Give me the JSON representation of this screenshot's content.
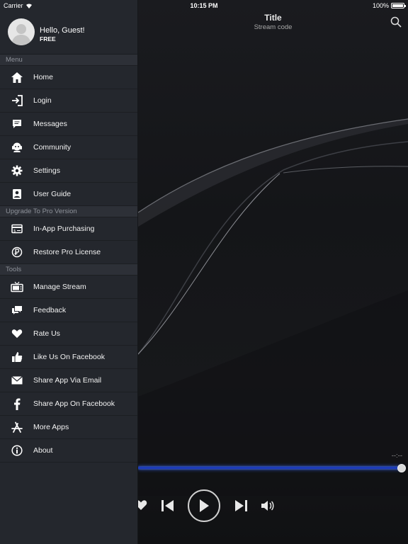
{
  "status_bar": {
    "carrier": "Carrier",
    "time": "10:15 PM",
    "battery": "100%"
  },
  "now_playing": {
    "title": "Title",
    "subtitle": "Stream code",
    "time_remaining": "--:--",
    "progress": 1.0
  },
  "profile": {
    "greeting": "Hello, Guest!",
    "tier": "FREE"
  },
  "menu": {
    "sections": [
      {
        "header": "Menu",
        "items": [
          {
            "label": "Home",
            "icon": "home-icon"
          },
          {
            "label": "Login",
            "icon": "login-icon"
          },
          {
            "label": "Messages",
            "icon": "messages-icon"
          },
          {
            "label": "Community",
            "icon": "community-icon"
          },
          {
            "label": "Settings",
            "icon": "gear-icon"
          },
          {
            "label": "User Guide",
            "icon": "user-guide-icon"
          }
        ]
      },
      {
        "header": "Upgrade To Pro Version",
        "items": [
          {
            "label": "In-App Purchasing",
            "icon": "purchase-icon"
          },
          {
            "label": "Restore Pro License",
            "icon": "restore-icon"
          }
        ]
      },
      {
        "header": "Tools",
        "items": [
          {
            "label": "Manage Stream",
            "icon": "tv-icon"
          },
          {
            "label": "Feedback",
            "icon": "feedback-icon"
          },
          {
            "label": "Rate Us",
            "icon": "heart-icon"
          },
          {
            "label": "Like Us On Facebook",
            "icon": "thumbs-up-icon"
          },
          {
            "label": "Share App Via Email",
            "icon": "email-icon"
          },
          {
            "label": "Share App On Facebook",
            "icon": "facebook-icon"
          },
          {
            "label": "More Apps",
            "icon": "app-store-icon"
          },
          {
            "label": "About",
            "icon": "info-icon"
          }
        ]
      }
    ]
  },
  "colors": {
    "sidebar_bg": "#24272d",
    "section_bg": "#2d3037",
    "progress_accent": "#1d3bb8"
  }
}
